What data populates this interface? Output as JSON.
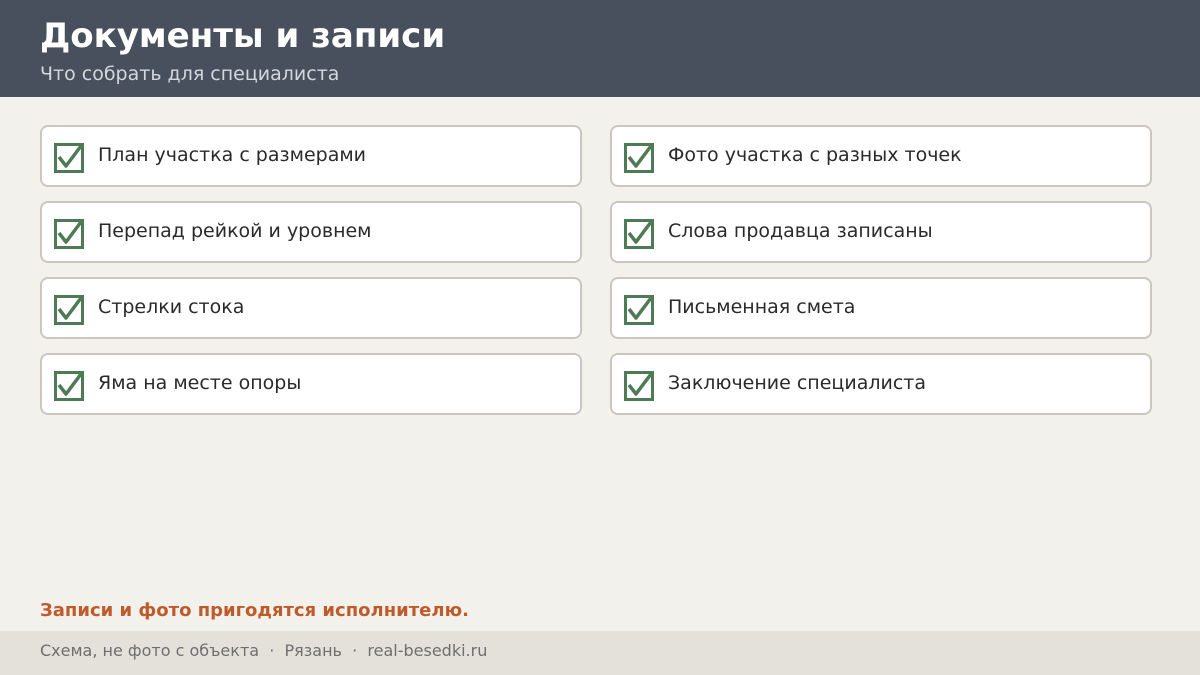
{
  "header": {
    "title": "Документы и записи",
    "subtitle": "Что собрать для специалиста"
  },
  "checklist": {
    "left": [
      {
        "label": "План участка с размерами",
        "checked": true
      },
      {
        "label": "Перепад рейкой и уровнем",
        "checked": true
      },
      {
        "label": "Стрелки стока",
        "checked": true
      },
      {
        "label": "Яма на месте опоры",
        "checked": true
      }
    ],
    "right": [
      {
        "label": "Фото участка с разных точек",
        "checked": true
      },
      {
        "label": "Слова продавца записаны",
        "checked": true
      },
      {
        "label": "Письменная смета",
        "checked": true
      },
      {
        "label": "Заключение специалиста",
        "checked": true
      }
    ]
  },
  "note": "Записи и фото пригодятся исполнителю.",
  "footer": {
    "text": "Схема, не фото с объекта  ·  Рязань  ·  real-besedki.ru"
  },
  "colors": {
    "header_bg": "#47505c",
    "check_green": "#4e7a55",
    "accent_orange": "#bf5a2a"
  },
  "icons": {
    "checkbox": "checked-checkbox-icon"
  }
}
